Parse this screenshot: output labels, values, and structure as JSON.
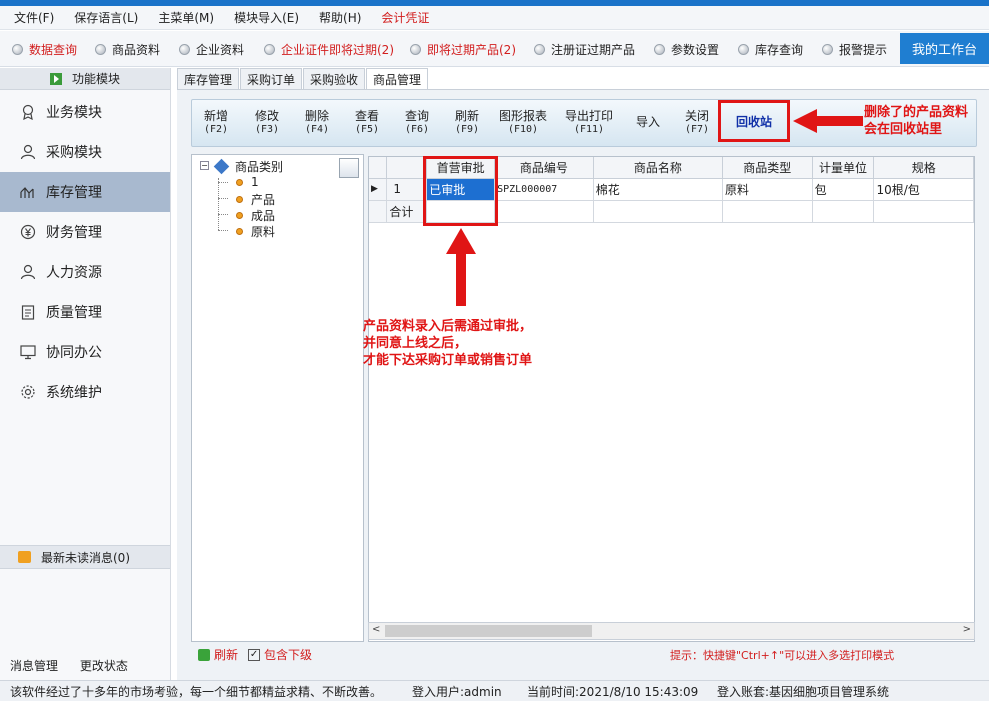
{
  "menu": [
    "文件(F)",
    "保存语言(L)",
    "主菜单(M)",
    "模块导入(E)",
    "帮助(H)",
    "会计凭证"
  ],
  "quick": [
    {
      "label": "数据查询",
      "red": true
    },
    {
      "label": "商品资料",
      "red": false
    },
    {
      "label": "企业资料",
      "red": false
    },
    {
      "label": "企业证件即将过期(2)",
      "red": true
    },
    {
      "label": "即将过期产品(2)",
      "red": true
    },
    {
      "label": "注册证过期产品",
      "red": false
    },
    {
      "label": "参数设置",
      "red": false
    },
    {
      "label": "库存查询",
      "red": false
    },
    {
      "label": "报警提示",
      "red": false
    }
  ],
  "workbench": "我的工作台",
  "sidebar": {
    "title": "功能模块",
    "items": [
      "业务模块",
      "采购模块",
      "库存管理",
      "财务管理",
      "人力资源",
      "质量管理",
      "协同办公",
      "系统维护"
    ],
    "msg": "最新未读消息(0)",
    "foot": [
      "消息管理",
      "更改状态"
    ]
  },
  "tabs": [
    "库存管理",
    "采购订单",
    "采购验收",
    "商品管理"
  ],
  "toolbar": [
    {
      "label": "新增",
      "key": "(F2)"
    },
    {
      "label": "修改",
      "key": "(F3)"
    },
    {
      "label": "删除",
      "key": "(F4)"
    },
    {
      "label": "查看",
      "key": "(F5)"
    },
    {
      "label": "查询",
      "key": "(F6)"
    },
    {
      "label": "刷新",
      "key": "(F9)"
    },
    {
      "label": "图形报表",
      "key": "(F10)"
    },
    {
      "label": "导出打印",
      "key": "(F11)"
    },
    {
      "label": "导入",
      "key": ""
    },
    {
      "label": "关闭",
      "key": "(F7)"
    }
  ],
  "recycle": "回收站",
  "tree": {
    "root": "商品类别",
    "children": [
      "1",
      "产品",
      "成品",
      "原料"
    ]
  },
  "grid": {
    "headers": [
      "首营审批",
      "商品编号",
      "商品名称",
      "商品类型",
      "计量单位",
      "规格"
    ],
    "row": {
      "no": "1",
      "cells": [
        "已审批",
        "SPZL000007",
        "棉花",
        "原料",
        "包",
        "10根/包"
      ]
    },
    "total_label": "合计"
  },
  "bottom": {
    "refresh": "刷新",
    "include_sub": "包含下级"
  },
  "hint": "提示：快捷键\"Ctrl+↑\"可以进入多选打印模式",
  "status": {
    "intro": "该软件经过了十多年的市场考验，每一个细节都精益求精、不断改善。",
    "user": "登入用户:admin",
    "time": "当前时间:2021/8/10 15:43:09",
    "account": "登入账套:基因细胞项目管理系统"
  },
  "annotations": {
    "recycle_note": [
      "删除了的产品资料",
      "会在回收站里"
    ],
    "approve_note": [
      "产品资料录入后需通过审批，",
      "并同意上线之后，",
      "才能下达采购订单或销售订单"
    ]
  }
}
